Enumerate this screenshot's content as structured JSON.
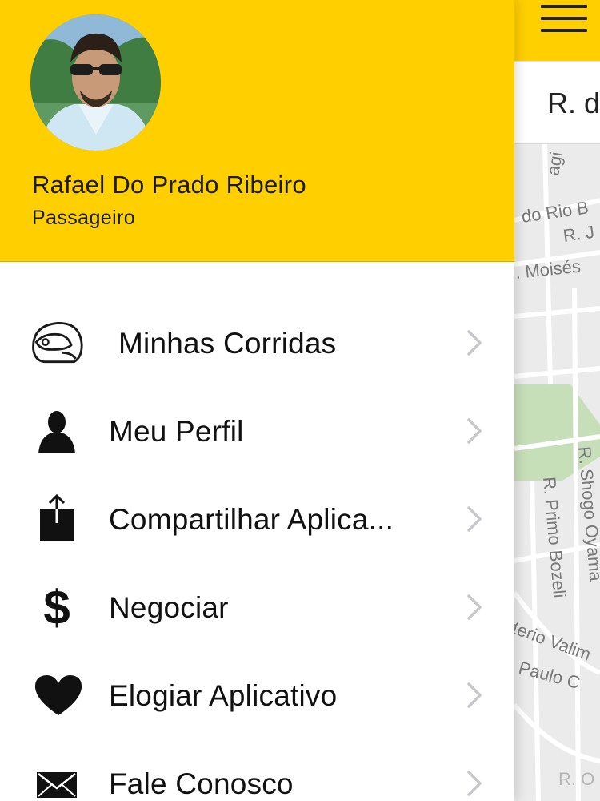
{
  "map_view": {
    "search_partial": "R. d",
    "street_labels": [
      "agi",
      "do Rio B",
      "R. J",
      ". Moisés",
      "R. Shogo Oyama",
      "R. Primo Bozeli",
      "terio Valim",
      "Paulo C",
      "R. O"
    ]
  },
  "drawer": {
    "header": {
      "user_name": "Rafael Do Prado Ribeiro",
      "user_role": "Passageiro"
    },
    "menu": [
      {
        "label": "Minhas Corridas",
        "icon": "helmet-icon"
      },
      {
        "label": "Meu Perfil",
        "icon": "person-icon"
      },
      {
        "label": "Compartilhar Aplica...",
        "icon": "share-icon"
      },
      {
        "label": "Negociar",
        "icon": "dollar-icon"
      },
      {
        "label": "Elogiar Aplicativo",
        "icon": "heart-icon"
      },
      {
        "label": "Fale Conosco",
        "icon": "envelope-icon"
      }
    ]
  },
  "colors": {
    "header_yellow": "#ffcf00",
    "map_background": "#ebebeb",
    "map_park": "#c7dfb8",
    "chevron_gray": "#c7c7cc"
  }
}
